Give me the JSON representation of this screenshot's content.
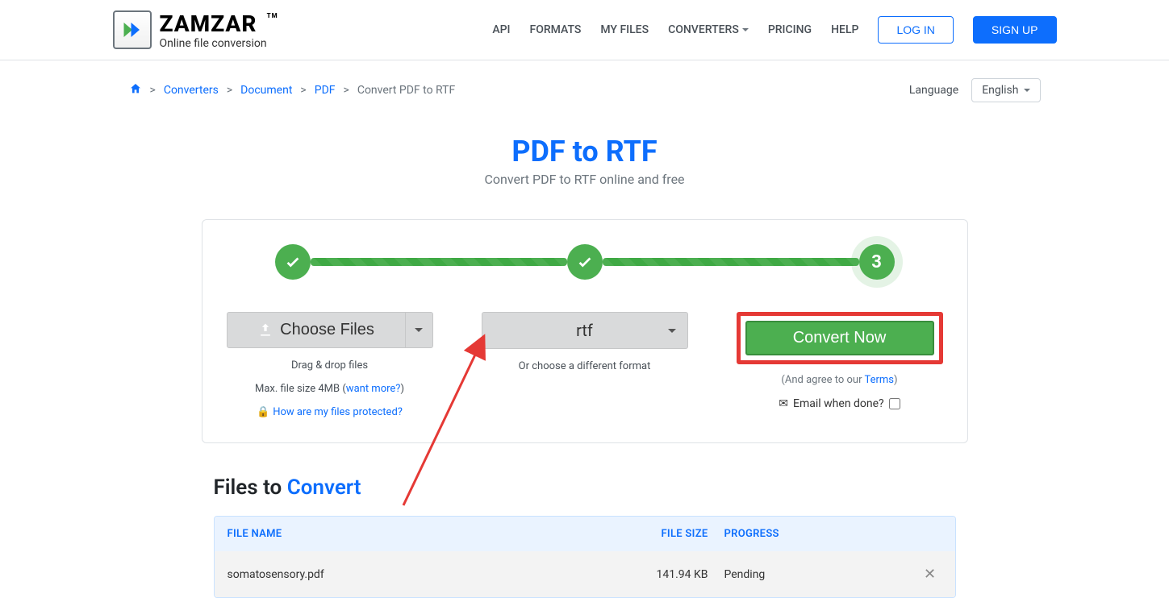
{
  "nav": {
    "logo_main": "ZAMZAR",
    "logo_tm": "TM",
    "logo_sub": "Online file conversion",
    "links": {
      "api": "API",
      "formats": "FORMATS",
      "myfiles": "MY FILES",
      "converters": "CONVERTERS",
      "pricing": "PRICING",
      "help": "HELP"
    },
    "login": "LOG IN",
    "signup": "SIGN UP"
  },
  "breadcrumb": {
    "converters": "Converters",
    "document": "Document",
    "pdf": "PDF",
    "current": "Convert PDF to RTF"
  },
  "lang": {
    "label": "Language",
    "value": "English"
  },
  "hero": {
    "title": "PDF to RTF",
    "sub": "Convert PDF to RTF online and free"
  },
  "stepper": {
    "step3": "3"
  },
  "step1": {
    "button": "Choose Files",
    "hint1": "Drag & drop files",
    "hint2_prefix": "Max. file size 4MB (",
    "hint2_link": "want more?",
    "hint2_suffix": ")",
    "hint3_link": "How are my files protected?"
  },
  "step2": {
    "format": "rtf",
    "hint": "Or choose a different format"
  },
  "step3": {
    "button": "Convert Now",
    "agree_prefix": "(And agree to our ",
    "agree_link": "Terms",
    "agree_suffix": ")",
    "email_label": "Email when done?"
  },
  "files": {
    "title_prefix": "Files to ",
    "title_accent": "Convert",
    "headers": {
      "name": "FILE NAME",
      "size": "FILE SIZE",
      "progress": "PROGRESS"
    },
    "rows": [
      {
        "name": "somatosensory.pdf",
        "size": "141.94 KB",
        "progress": "Pending"
      }
    ]
  }
}
